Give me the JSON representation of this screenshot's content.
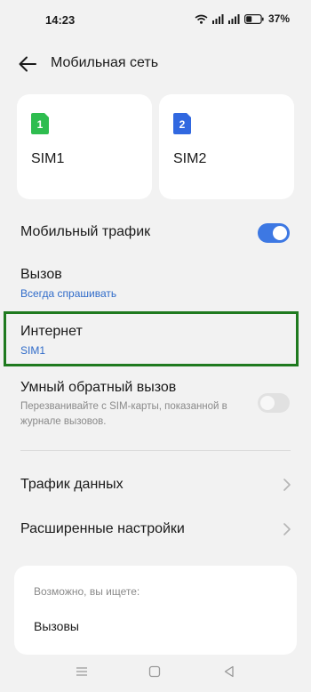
{
  "status": {
    "time": "14:23",
    "battery": "37%"
  },
  "header": {
    "title": "Мобильная сеть"
  },
  "sims": [
    {
      "num": "1",
      "label": "SIM1",
      "color": "#2ebd4f"
    },
    {
      "num": "2",
      "label": "SIM2",
      "color": "#3168e0"
    }
  ],
  "settings": {
    "mobile_traffic": {
      "title": "Мобильный трафик",
      "enabled": true
    },
    "call": {
      "title": "Вызов",
      "value": "Всегда спрашивать"
    },
    "internet": {
      "title": "Интернет",
      "value": "SIM1"
    },
    "smart_callback": {
      "title": "Умный обратный вызов",
      "desc": "Перезванивайте с SIM-карты, показанной в журнале вызовов.",
      "enabled": false
    },
    "data_traffic": {
      "title": "Трафик данных"
    },
    "advanced": {
      "title": "Расширенные настройки"
    }
  },
  "suggestions": {
    "heading": "Возможно, вы ищете:",
    "items": [
      "Вызовы"
    ]
  },
  "colors": {
    "accent": "#3d78e3",
    "highlight": "#1f7a1f"
  }
}
